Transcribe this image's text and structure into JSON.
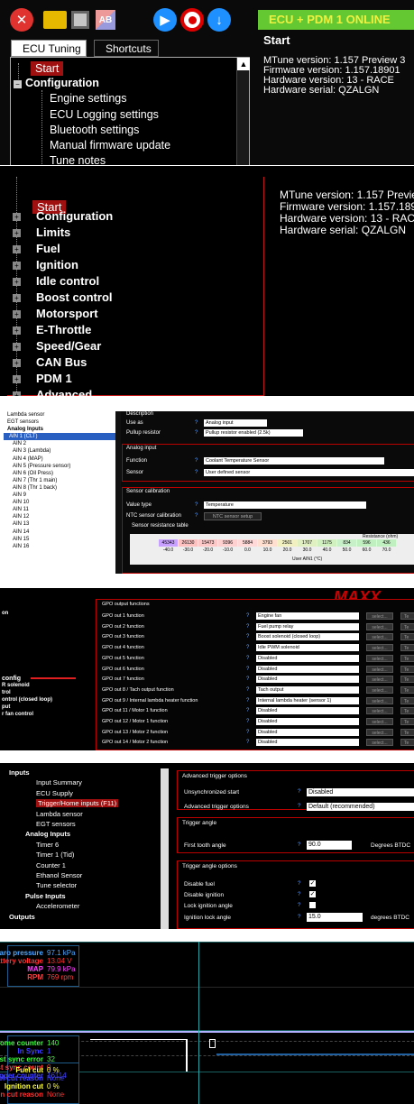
{
  "toolbar": {
    "status": "ECU + PDM 1 ONLINE"
  },
  "tabs": [
    "ECU Tuning",
    "Shortcuts"
  ],
  "tree1": {
    "start": "Start",
    "configuration": "Configuration",
    "children": [
      "Engine settings",
      "ECU Logging settings",
      "Bluetooth settings",
      "Manual firmware update",
      "Tune notes"
    ]
  },
  "info1": {
    "title": "Start",
    "lines": [
      "MTune version: 1.157 Preview 3",
      "Firmware version: 1.157.18901",
      "Hardware version: 13  - RACE",
      "Hardware serial: QZALGN"
    ]
  },
  "tree2": {
    "start": "Start",
    "items": [
      "Configuration",
      "Limits",
      "Fuel",
      "Ignition",
      "Idle control",
      "Boost control",
      "Motorsport",
      "E-Throttle",
      "Speed/Gear",
      "CAN Bus",
      "PDM 1",
      "Advanced"
    ]
  },
  "info2": {
    "lines": [
      "MTune version: 1.157 Preview 3",
      "Firmware version: 1.157.18901",
      "Hardware version: 13  - RACE",
      "Hardware serial: QZALGN"
    ]
  },
  "p3": {
    "list": [
      "Lambda sensor",
      "EGT sensors",
      "Analog Inputs",
      "AIN 1 (CLT)",
      "AIN 2",
      "AIN 3 (Lambda)",
      "AIN 4 (MAP)",
      "AIN 5 (Pressure sensor)",
      "AIN 6 (Oil Press)",
      "AIN 7 (Thr 1 main)",
      "AIN 8 (Thr 1 back)",
      "AIN 9",
      "AIN 10",
      "AIN 11",
      "AIN 12",
      "AIN 13",
      "AIN 14",
      "AIN 15",
      "AIN 16"
    ],
    "desc_label": "Description",
    "use_as_label": "Use as",
    "use_as_value": "Analog input",
    "pullup_label": "Pullup resistor",
    "pullup_value": "Pullup resistor enabled (2.5k)",
    "analog_input_header": "Analog input",
    "function_label": "Function",
    "function_value": "Coolant Temperature Sensor",
    "sensor_label": "Sensor",
    "sensor_value": "User defined sensor",
    "calib_header": "Sensor calibration",
    "value_type_label": "Value type",
    "value_type_value": "Temperature",
    "ntc_label": "NTC sensor calibration",
    "ntc_button": "NTC sensor setup",
    "table_header": "Sensor resistance table",
    "resistance_label": "Resistance (ohm)",
    "resistance": [
      "45343",
      "26130",
      "15473",
      "9396",
      "5884",
      "3793",
      "2501",
      "1707",
      "1175",
      "834",
      "596",
      "436"
    ],
    "temps": [
      "-40.0",
      "-30.0",
      "-20.0",
      "-10.0",
      "0.0",
      "10.0",
      "20.0",
      "30.0",
      "40.0",
      "50.0",
      "60.0",
      "70.0"
    ],
    "axis_label": "User AIN1 (°C)"
  },
  "p4": {
    "side": [
      "on",
      "config",
      "R solenoid",
      "trol",
      "ontrol (closed loop)",
      "put",
      "r fan control"
    ],
    "header": "GPO output functions",
    "brand": "MAXX",
    "rows": [
      {
        "label": "GPO out 1 function",
        "value": "Engine fan"
      },
      {
        "label": "GPO out 2 function",
        "value": "Fuel pump relay"
      },
      {
        "label": "GPO out 3 function",
        "value": "Boost solenoid (closed loop)"
      },
      {
        "label": "GPO out 4 function",
        "value": "Idle PWM solenoid"
      },
      {
        "label": "GPO out 5 function",
        "value": "Disabled"
      },
      {
        "label": "GPO out 6 function",
        "value": "Disabled"
      },
      {
        "label": "GPO out 7 function",
        "value": "Disabled"
      },
      {
        "label": "GPO out 8 / Tach output function",
        "value": "Tach output"
      },
      {
        "label": "GPO out 9 / Internal lambda heater function",
        "value": "Internal lambda heater (sensor 1)"
      },
      {
        "label": "GPO out 11 / Motor 1 function",
        "value": "Disabled"
      },
      {
        "label": "GPO out 12 / Motor 1 function",
        "value": "Disabled"
      },
      {
        "label": "GPO out 13 / Motor 2 function",
        "value": "Disabled"
      },
      {
        "label": "GPO out 14 / Motor 2 function",
        "value": "Disabled"
      }
    ],
    "select": "select...",
    "te": "Te"
  },
  "p5": {
    "tree": [
      "Inputs",
      "Input Summary",
      "ECU Supply",
      "Trigger/Home inputs (F11)",
      "Lambda sensor",
      "EGT sensors",
      "Analog Inputs",
      "Timer 6",
      "Timer 1 (Tid)",
      "Counter 1",
      "Ethanol Sensor",
      "Tune selector",
      "Pulse Inputs",
      "Accelerometer",
      "Outputs"
    ],
    "adv_header": "Advanced trigger options",
    "unsync_label": "Unsynchronized start",
    "unsync_value": "Disabled",
    "adv_label": "Advanced trigger options",
    "adv_value": "Default (recommended)",
    "angle_header": "Trigger angle",
    "first_tooth_label": "First tooth angle",
    "first_tooth_value": "90.0",
    "first_tooth_unit": "Degrees BTDC",
    "angle_opts_header": "Trigger angle options",
    "disable_fuel": "Disable fuel",
    "disable_ign": "Disable ignition",
    "lock_ign": "Lock ignition angle",
    "ign_lock_label": "Ignition lock angle",
    "ign_lock_value": "15.0",
    "ign_lock_unit": "degrees BTDC"
  },
  "p6": {
    "block1": [
      {
        "label": "Baro pressure",
        "value": "97.1 kPa",
        "color": "#4da6ff"
      },
      {
        "label": "Battery voltage",
        "value": "13.04 V",
        "color": "#ff3030"
      },
      {
        "label": "MAP",
        "value": "79.9 kPa",
        "color": "#ff40ff"
      },
      {
        "label": "RPM",
        "value": "769 rpm",
        "color": "#ff4040"
      }
    ],
    "block2": [
      {
        "label": "Home counter",
        "value": "140",
        "color": "#40ff40"
      },
      {
        "label": "In Sync",
        "value": "1",
        "color": "#4040ff"
      },
      {
        "label": "Last sync error",
        "value": "32",
        "color": "#40ff40"
      },
      {
        "label": "Lost sync count",
        "value": "0",
        "color": "#ff4040"
      },
      {
        "label": "Trigger counter",
        "value": "16114",
        "color": "#4040ff"
      }
    ],
    "block3": [
      {
        "label": "Fuel cut",
        "value": "0 %",
        "color": "#ffff40"
      },
      {
        "label": "Fuel cut reason",
        "value": "None",
        "color": "#4040ff"
      },
      {
        "label": "Ignition cut",
        "value": "0 %",
        "color": "#ffff40"
      },
      {
        "label": "Ignition cut reason",
        "value": "None",
        "color": "#ff3030"
      }
    ]
  }
}
